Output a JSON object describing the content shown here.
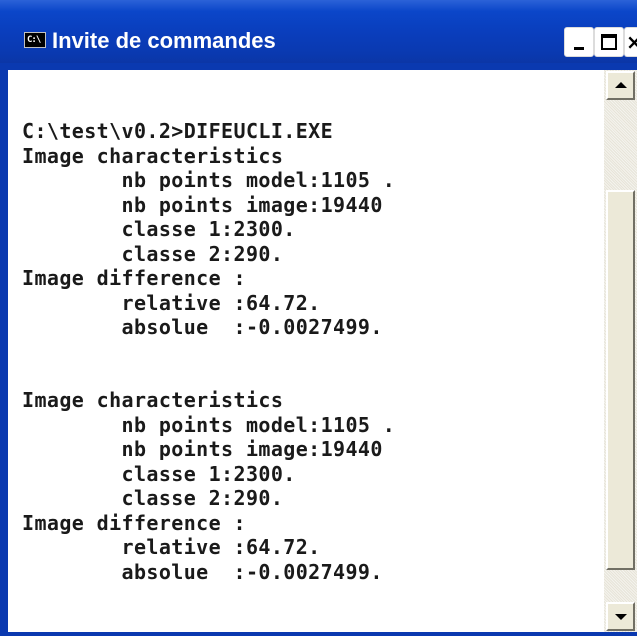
{
  "window": {
    "title": "Invite de commandes",
    "icon": "cmd-icon",
    "icon_text": "C:\\"
  },
  "controls": {
    "minimize": "minimize-icon",
    "maximize": "maximize-icon",
    "close": "close-icon",
    "close_glyph": "×"
  },
  "console": {
    "lines": [
      "C:\\test\\v0.2>DIFEUCLI.EXE",
      "Image characteristics",
      "        nb points model:1105 .",
      "        nb points image:19440",
      "        classe 1:2300.",
      "        classe 2:290.",
      "Image difference :",
      "        relative :64.72.",
      "        absolue  :-0.0027499.",
      "",
      "",
      "Image characteristics",
      "        nb points model:1105 .",
      "        nb points image:19440",
      "        classe 1:2300.",
      "        classe 2:290.",
      "Image difference :",
      "        relative :64.72.",
      "        absolue  :-0.0027499."
    ]
  },
  "scrollbar": {
    "up": "arrow-up-icon",
    "down": "arrow-down-icon"
  },
  "colors": {
    "titlebar": "#0a39b0",
    "console_bg": "#ffffff",
    "console_text": "#1a1a1a"
  }
}
